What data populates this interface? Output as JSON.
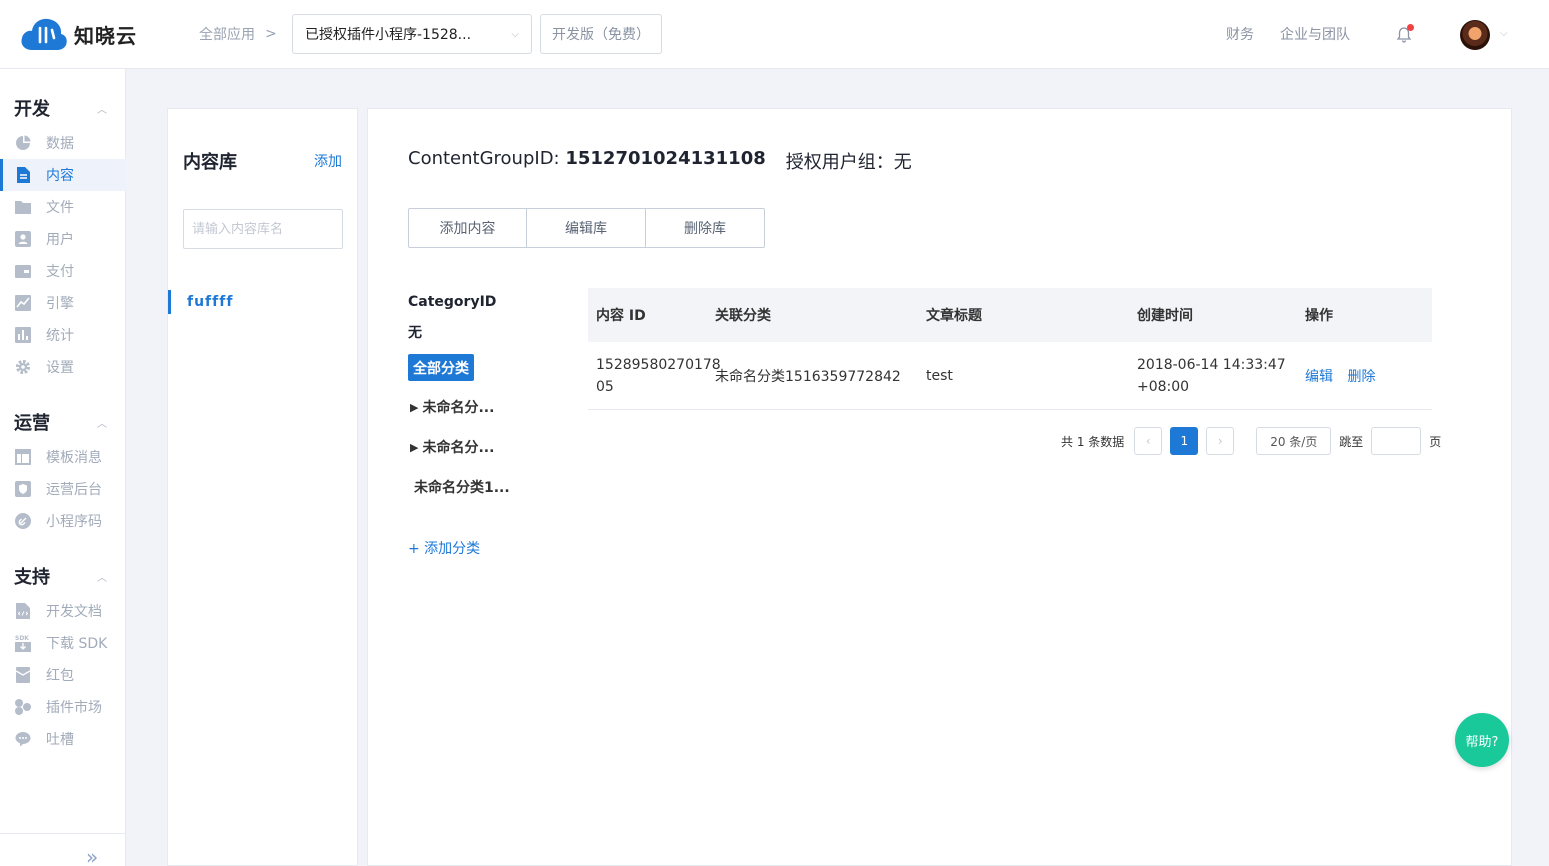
{
  "header": {
    "logo_text": "知晓云",
    "breadcrumb": "全部应用",
    "app_select": "已授权插件小程序-1528...",
    "plan": "开发版（免费）",
    "links": [
      "财务",
      "企业与团队"
    ]
  },
  "sidebar": {
    "sections": [
      {
        "title": "开发",
        "items": [
          {
            "label": "数据",
            "icon": "pie-chart-icon"
          },
          {
            "label": "内容",
            "icon": "document-icon",
            "active": true
          },
          {
            "label": "文件",
            "icon": "folder-icon"
          },
          {
            "label": "用户",
            "icon": "user-card-icon"
          },
          {
            "label": "支付",
            "icon": "wallet-icon"
          },
          {
            "label": "引擎",
            "icon": "trend-icon"
          },
          {
            "label": "统计",
            "icon": "bar-chart-icon"
          },
          {
            "label": "设置",
            "icon": "gear-icon"
          }
        ]
      },
      {
        "title": "运营",
        "items": [
          {
            "label": "模板消息",
            "icon": "template-icon"
          },
          {
            "label": "运营后台",
            "icon": "shield-icon"
          },
          {
            "label": "小程序码",
            "icon": "link-icon"
          }
        ]
      },
      {
        "title": "支持",
        "items": [
          {
            "label": "开发文档",
            "icon": "code-doc-icon"
          },
          {
            "label": "下载 SDK",
            "icon": "sdk-download-icon"
          },
          {
            "label": "红包",
            "icon": "red-packet-icon"
          },
          {
            "label": "插件市场",
            "icon": "plugin-icon"
          },
          {
            "label": "吐槽",
            "icon": "chat-icon"
          }
        ]
      }
    ]
  },
  "library": {
    "title": "内容库",
    "add_label": "添加",
    "search_placeholder": "请输入内容库名",
    "items": [
      "fuffff"
    ]
  },
  "main": {
    "group_id_label": "ContentGroupID:",
    "group_id": "1512701024131108",
    "auth_label": "授权用户组：无",
    "buttons": [
      "添加内容",
      "编辑库",
      "删除库"
    ],
    "category": {
      "label": "CategoryID",
      "value": "无",
      "all": "全部分类",
      "nodes": [
        "未命名分...",
        "未命名分...",
        "未命名分类1..."
      ],
      "add": "+ 添加分类"
    },
    "table": {
      "headers": [
        "内容 ID",
        "关联分类",
        "文章标题",
        "创建时间",
        "操作"
      ],
      "rows": [
        {
          "id_line1": "15289580270178",
          "id_line2": "05",
          "category": "未命名分类1516359772842",
          "title": "test",
          "time_line1": "2018-06-14 14:33:47",
          "time_line2": "+08:00",
          "ops": [
            "编辑",
            "删除"
          ]
        }
      ]
    },
    "pager": {
      "total": "共 1 条数据",
      "prev": "‹",
      "current": "1",
      "next": "›",
      "page_size": "20 条/页",
      "jump_label": "跳至",
      "page_unit": "页"
    }
  },
  "help_label": "帮助?"
}
